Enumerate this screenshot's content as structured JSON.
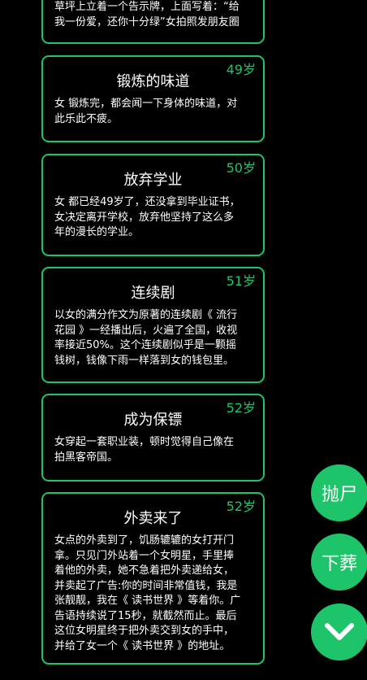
{
  "events": [
    {
      "age": "",
      "title": "",
      "body": "草坪上立着一个告示牌，上面写着：“给\n我一份爱，还你十分绿”女拍照发朋友圈"
    },
    {
      "age": "49岁",
      "title": "锻炼的味道",
      "body": "女 锻炼完，都会闻一下身体的味道，对\n此乐此不疲。"
    },
    {
      "age": "50岁",
      "title": "放弃学业",
      "body": "女 都已经49岁了，还没拿到毕业证书，\n女决定离开学校，放弃他坚持了这么多\n年的漫长的学业。"
    },
    {
      "age": "51岁",
      "title": "连续剧",
      "body": "以女的满分作文为原著的连续剧《 流行\n花园 》一经播出后，火遍了全国，收视\n率接近50%。这个连续剧似乎是一颗摇\n钱树，钱像下雨一样落到女的钱包里。"
    },
    {
      "age": "52岁",
      "title": "成为保镖",
      "body": "女穿起一套职业装，顿时觉得自己像在\n拍黑客帝国。"
    },
    {
      "age": "52岁",
      "title": "外卖来了",
      "body": "女点的外卖到了，饥肠辘辘的女打开门\n拿。只见门外站着一个女明星，手里捧\n着他的外卖，她不急着把外卖递给女，\n并卖起了广告:你的时间非常值钱，我是\n张靓靓，我在《 读书世界 》等着你。广\n告语持续说了15秒，就截然而止。最后\n这位女明星终于把外卖交到女的手中，\n并给了女一个《 读书世界 》的地址。"
    }
  ],
  "actions": {
    "throw_label": "抛尸",
    "bury_label": "下葬",
    "scroll_icon": "chevron-down-icon"
  },
  "colors": {
    "accent": "#1ec46a",
    "background": "#000000",
    "text": "#ffffff"
  }
}
